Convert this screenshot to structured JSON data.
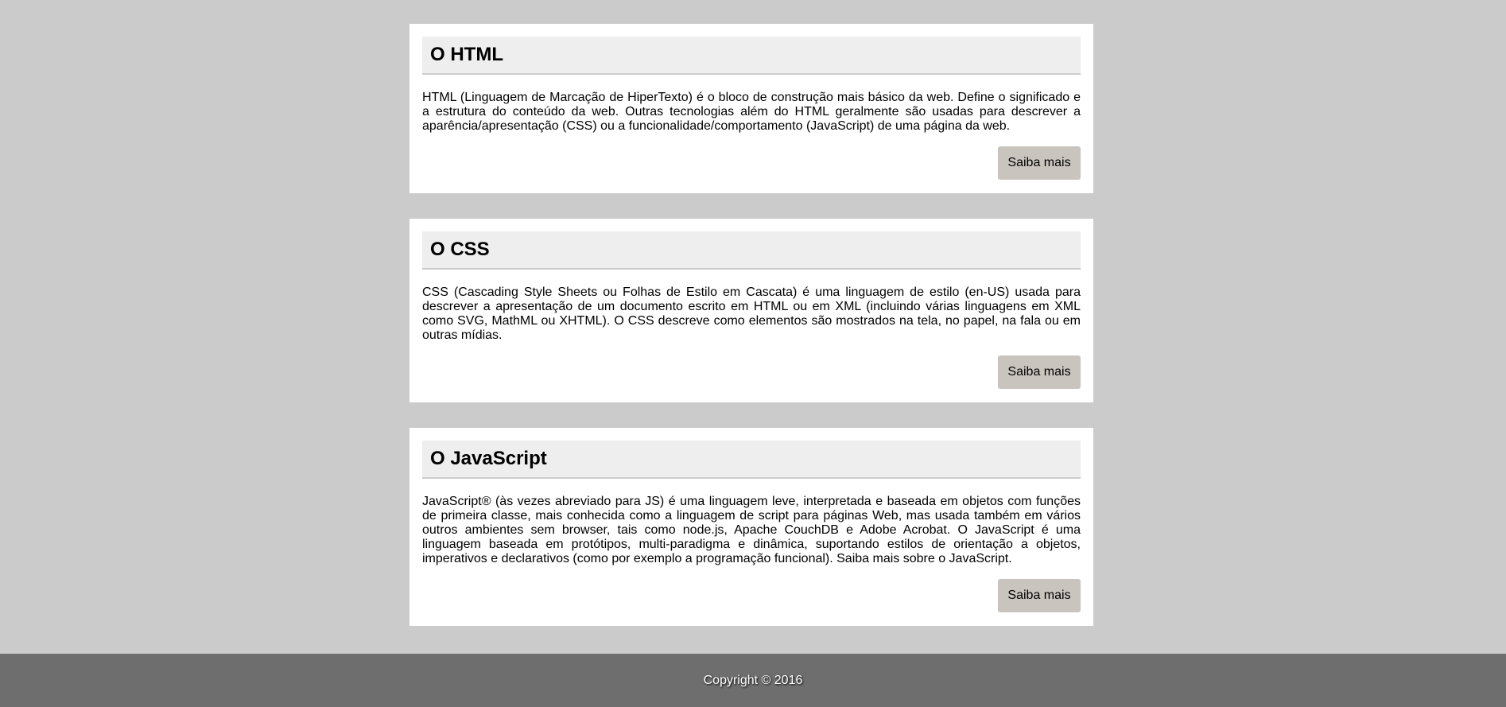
{
  "cards": [
    {
      "title": "O HTML",
      "text": "HTML (Linguagem de Marcação de HiperTexto) é o bloco de construção mais básico da web. Define o significado e a estrutura do conteúdo da web. Outras tecnologias além do HTML geralmente são usadas para descrever a aparência/apresentação (CSS) ou a funcionalidade/comportamento (JavaScript) de uma página da web.",
      "button_label": "Saiba mais"
    },
    {
      "title": "O CSS",
      "text": "CSS (Cascading Style Sheets ou Folhas de Estilo em Cascata) é uma linguagem de estilo (en-US) usada para descrever a apresentação de um documento escrito em HTML ou em XML (incluindo várias linguagens em XML como SVG, MathML ou XHTML). O CSS descreve como elementos são mostrados na tela, no papel, na fala ou em outras mídias.",
      "button_label": "Saiba mais"
    },
    {
      "title": "O JavaScript",
      "text": "JavaScript® (às vezes abreviado para JS) é uma linguagem leve, interpretada e baseada em objetos com funções de primeira classe, mais conhecida como a linguagem de script para páginas Web, mas usada também em vários outros ambientes sem browser, tais como node.js, Apache CouchDB e Adobe Acrobat. O JavaScript é uma linguagem baseada em protótipos, multi-paradigma e dinâmica, suportando estilos de orientação a objetos, imperativos e declarativos (como por exemplo a programação funcional). Saiba mais sobre o JavaScript.",
      "button_label": "Saiba mais"
    }
  ],
  "footer": {
    "copyright": "Copyright © 2016"
  },
  "colors": {
    "page_background": "#cbcbcb",
    "card_background": "#ffffff",
    "card_header_background": "#eeeeee",
    "button_background": "#c9c4be",
    "footer_background": "#6d6e6d"
  }
}
